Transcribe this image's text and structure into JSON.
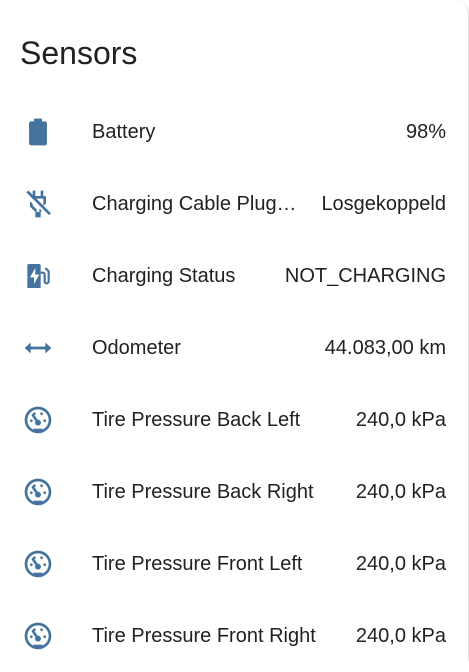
{
  "card": {
    "title": "Sensors"
  },
  "colors": {
    "icon": "#44739e",
    "text": "#212121"
  },
  "rows": [
    {
      "icon": "battery-icon",
      "name": "Battery",
      "value": "98%"
    },
    {
      "icon": "power-plug-off-icon",
      "name": "Charging Cable Plug…",
      "value": "Losgekoppeld"
    },
    {
      "icon": "ev-station-icon",
      "name": "Charging Status",
      "value": "NOT_CHARGING"
    },
    {
      "icon": "arrow-left-right-icon",
      "name": "Odometer",
      "value": "44.083,00 km"
    },
    {
      "icon": "gauge-icon",
      "name": "Tire Pressure Back Left",
      "value": "240,0 kPa"
    },
    {
      "icon": "gauge-icon",
      "name": "Tire Pressure Back Right",
      "value": "240,0 kPa"
    },
    {
      "icon": "gauge-icon",
      "name": "Tire Pressure Front Left",
      "value": "240,0 kPa"
    },
    {
      "icon": "gauge-icon",
      "name": "Tire Pressure Front Right",
      "value": "240,0 kPa"
    }
  ]
}
